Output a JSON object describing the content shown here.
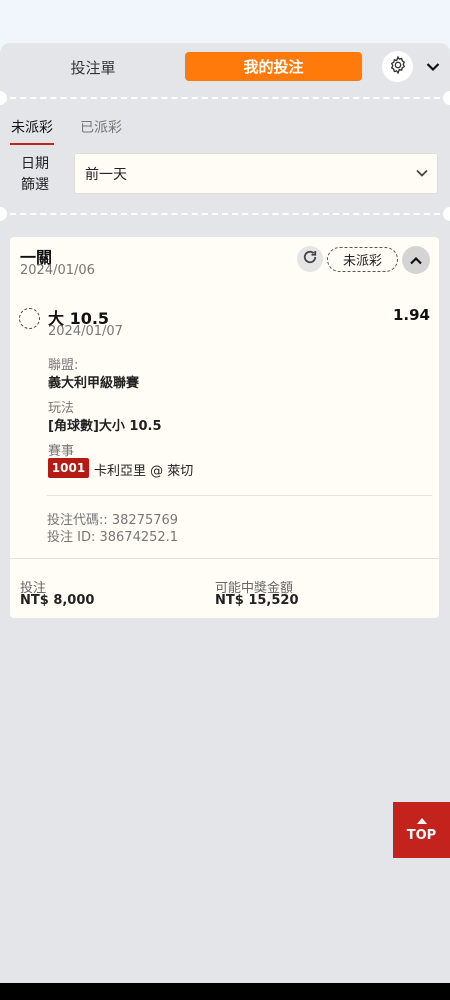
{
  "header": {
    "betslip_tab": "投注單",
    "mybets_tab": "我的投注"
  },
  "subtabs": {
    "unsettled": "未派彩",
    "settled": "已派彩"
  },
  "date_filter": {
    "label_line1": "日期",
    "label_line2": "篩選",
    "value": "前一天"
  },
  "bet": {
    "type": "一關",
    "date": "2024/01/06",
    "status": "未派彩",
    "selection": {
      "name": "大 10.5",
      "date": "2024/01/07",
      "odds": "1.94",
      "league_label": "聯盟:",
      "league": "義大利甲級聯賽",
      "market_label": "玩法",
      "market": "[角球數]大小 10.5",
      "event_label": "賽事",
      "event_id": "1001",
      "event_name": "卡利亞里 @ 萊切"
    },
    "code_line": "投注代碼:: 38275769",
    "id_line": "投注 ID: 38674252.1",
    "stake_label": "投注",
    "stake_value": "NT$ 8,000",
    "return_label": "可能中獎金額",
    "return_value": "NT$ 15,520"
  },
  "top_button": "TOP",
  "colors": {
    "accent_orange": "#ff7a0a",
    "brand_red": "#c4221c"
  },
  "icons": [
    "gear-icon",
    "chevron-down-icon",
    "refresh-icon",
    "chevron-up-icon",
    "arrow-up-icon"
  ]
}
